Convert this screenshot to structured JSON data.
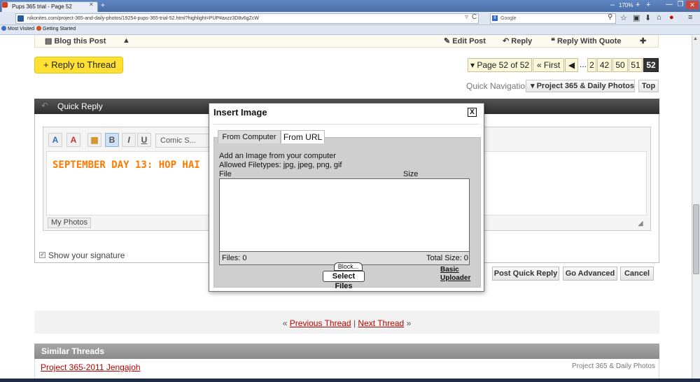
{
  "browser": {
    "tab_title": "Pups 365 trial - Page 52",
    "new_tab": "+",
    "zoom": "170%",
    "zoom_minus": "–",
    "zoom_plus": "+",
    "url": "nikonites.com/project-365-and-daily-photos/19254-pups-365-trial-52.html?highlight=PUP#axzz3D8v6gZcW",
    "search_placeholder": "Google",
    "bookmarks": [
      "Most Visited",
      "Getting Started"
    ]
  },
  "postbar": {
    "blog": "Blog this Post",
    "edit": "Edit Post",
    "reply": "Reply",
    "reply_quote": "Reply With Quote"
  },
  "reply_to_thread": "+ Reply to Thread",
  "pagination": {
    "label": "Page 52 of 52",
    "first": "First",
    "ellipsis": "...",
    "pages": [
      "2",
      "42",
      "50",
      "51",
      "52"
    ]
  },
  "quick_nav": {
    "label": "Quick Navigation",
    "forum": "Project 365 & Daily Photos",
    "top": "Top"
  },
  "quick_reply": {
    "title": "Quick Reply",
    "font": "Comic S...",
    "editor_text": "SEPTEMBER DAY 13:  HOP HAI",
    "my_photos": "My Photos",
    "show_signature": "Show your signature",
    "post_btn": "Post Quick Reply",
    "advanced_btn": "Go Advanced",
    "cancel_btn": "Cancel"
  },
  "modal": {
    "title": "Insert Image",
    "close": "X",
    "tab_computer": "From Computer",
    "tab_url": "From URL",
    "line1": "Add an Image from your computer",
    "line2": "Allowed Filetypes: jpg, jpeg, png, gif",
    "col_file": "File",
    "col_size": "Size",
    "files": "Files: 0",
    "total_size": "Total Size: 0",
    "block": "Block...",
    "select_files": "Select Files",
    "basic_line1": "Basic",
    "basic_line2": "Uploader"
  },
  "thread_nav": {
    "prev": "Previous Thread",
    "next": "Next Thread",
    "left": "«",
    "right": "»",
    "sep": "|"
  },
  "similar": {
    "title": "Similar Threads",
    "thread": "Project 365-2011 Jengajoh",
    "forum": "Project 365 & Daily Photos"
  }
}
